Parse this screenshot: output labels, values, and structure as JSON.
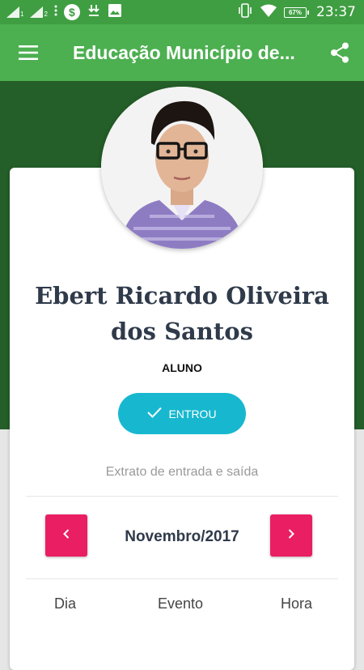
{
  "status_bar": {
    "sim1": "1",
    "sim2": "2",
    "battery_percent": "67%",
    "time": "23:37",
    "icons": [
      "signal-icon",
      "signal-icon",
      "more-icon",
      "dollar-icon",
      "download-icon",
      "image-icon",
      "vibrate-icon",
      "wifi-icon",
      "battery-icon"
    ]
  },
  "app_bar": {
    "title": "Educação Município de...",
    "menu_icon": "hamburger-menu-icon",
    "share_icon": "share-icon"
  },
  "colors": {
    "status_bar": "#3f9e42",
    "app_bar": "#4caf50",
    "hero": "#245e28",
    "status_button": "#17b8cf",
    "nav_button": "#e91e63"
  },
  "profile": {
    "name": "Ebert Ricardo Oliveira dos Santos",
    "role": "ALUNO",
    "status_label": "ENTROU"
  },
  "extract": {
    "caption": "Extrato de entrada e saída",
    "month": "Novembro/2017",
    "columns": [
      "Dia",
      "Evento",
      "Hora"
    ]
  }
}
